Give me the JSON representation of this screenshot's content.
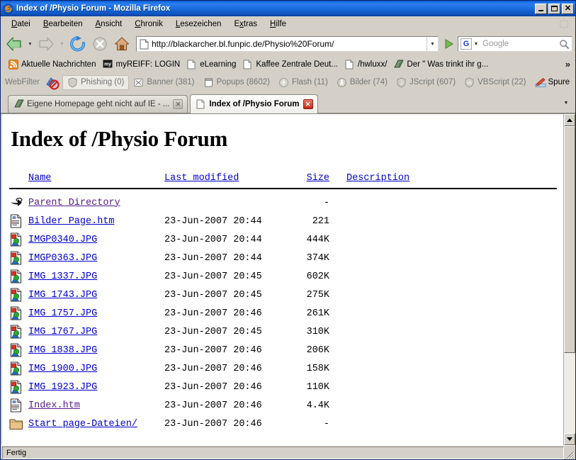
{
  "window": {
    "title": "Index of /Physio Forum - Mozilla Firefox",
    "minimize_label": "Minimize",
    "maximize_label": "Maximize",
    "close_label": "Close"
  },
  "menu": {
    "items": [
      {
        "label": "Datei",
        "accel": "D"
      },
      {
        "label": "Bearbeiten",
        "accel": "B"
      },
      {
        "label": "Ansicht",
        "accel": "A"
      },
      {
        "label": "Chronik",
        "accel": "C"
      },
      {
        "label": "Lesezeichen",
        "accel": "L"
      },
      {
        "label": "Extras",
        "accel": "x"
      },
      {
        "label": "Hilfe",
        "accel": "H"
      }
    ]
  },
  "toolbar": {
    "back_label": "Zurück",
    "forward_label": "Vor",
    "reload_label": "Neu laden",
    "stop_label": "Stopp",
    "home_label": "Startseite",
    "go_label": "Gehe zu"
  },
  "url_bar": {
    "value": "http://blackarcher.bl.funpic.de/Physio%20Forum/",
    "dropdown_label": "▼"
  },
  "search_bar": {
    "engine": "G",
    "placeholder": "Google",
    "value": ""
  },
  "bookmarks": {
    "items": [
      {
        "label": "Aktuelle Nachrichten",
        "icon": "rss-icon"
      },
      {
        "label": "myREIFF: LOGIN",
        "icon": "my-badge-icon"
      },
      {
        "label": "eLearning",
        "icon": "page-icon"
      },
      {
        "label": "Kaffee Zentrale Deut...",
        "icon": "page-icon"
      },
      {
        "label": "/hwluxx/",
        "icon": "page-icon"
      },
      {
        "label": "Der \" Was trinkt ihr g...",
        "icon": "book-icon"
      }
    ],
    "overflow_label": "»"
  },
  "webfilter": {
    "label": "WebFilter",
    "items": [
      {
        "label": "Phishing (0)",
        "icon": "shield-icon",
        "active": true
      },
      {
        "label": "Banner (381)",
        "icon": "banner-icon",
        "active": false
      },
      {
        "label": "Popups (8602)",
        "icon": "popup-icon",
        "active": false
      },
      {
        "label": "Flash (11)",
        "icon": "flash-icon",
        "active": false
      },
      {
        "label": "Bilder (74)",
        "icon": "image-icon",
        "active": false
      },
      {
        "label": "JScript (607)",
        "icon": "jscript-icon",
        "active": false
      },
      {
        "label": "VBScript (22)",
        "icon": "vbscript-icon",
        "active": false
      },
      {
        "label": "Spure",
        "icon": "pencil-icon",
        "active": false
      }
    ]
  },
  "tabs": {
    "list": [
      {
        "label": "Eigene Homepage geht nicht auf IE - ...",
        "active": false
      },
      {
        "label": "Index of /Physio Forum",
        "active": true
      }
    ],
    "dropdown_label": "▼"
  },
  "page": {
    "title": "Index of /Physio Forum",
    "columns": {
      "name": "Name",
      "last_modified": "Last modified",
      "size": "Size",
      "description": "Description"
    },
    "rows": [
      {
        "icon": "parent-dir-icon",
        "name": "Parent Directory",
        "date": "",
        "size": "-",
        "desc": "",
        "visited": true
      },
      {
        "icon": "text-doc-icon",
        "name": "Bilder Page.htm",
        "date": "23-Jun-2007 20:44",
        "size": "221",
        "desc": "",
        "visited": false
      },
      {
        "icon": "image-file-icon",
        "name": "IMGP0340.JPG",
        "date": "23-Jun-2007 20:44",
        "size": "444K",
        "desc": "",
        "visited": false
      },
      {
        "icon": "image-file-icon",
        "name": "IMGP0363.JPG",
        "date": "23-Jun-2007 20:44",
        "size": "374K",
        "desc": "",
        "visited": false
      },
      {
        "icon": "image-file-icon",
        "name": "IMG 1337.JPG",
        "date": "23-Jun-2007 20:45",
        "size": "602K",
        "desc": "",
        "visited": false
      },
      {
        "icon": "image-file-icon",
        "name": "IMG 1743.JPG",
        "date": "23-Jun-2007 20:45",
        "size": "275K",
        "desc": "",
        "visited": false
      },
      {
        "icon": "image-file-icon",
        "name": "IMG 1757.JPG",
        "date": "23-Jun-2007 20:46",
        "size": "261K",
        "desc": "",
        "visited": false
      },
      {
        "icon": "image-file-icon",
        "name": "IMG 1767.JPG",
        "date": "23-Jun-2007 20:45",
        "size": "310K",
        "desc": "",
        "visited": false
      },
      {
        "icon": "image-file-icon",
        "name": "IMG 1838.JPG",
        "date": "23-Jun-2007 20:46",
        "size": "206K",
        "desc": "",
        "visited": false
      },
      {
        "icon": "image-file-icon",
        "name": "IMG 1900.JPG",
        "date": "23-Jun-2007 20:46",
        "size": "158K",
        "desc": "",
        "visited": false
      },
      {
        "icon": "image-file-icon",
        "name": "IMG 1923.JPG",
        "date": "23-Jun-2007 20:46",
        "size": "110K",
        "desc": "",
        "visited": false
      },
      {
        "icon": "text-doc-icon",
        "name": "Index.htm",
        "date": "23-Jun-2007 20:46",
        "size": "4.4K",
        "desc": "",
        "visited": true
      },
      {
        "icon": "folder-icon",
        "name": "Start page-Dateien/",
        "date": "23-Jun-2007 20:46",
        "size": "-",
        "desc": "",
        "visited": false
      }
    ]
  },
  "status": {
    "text": "Fertig"
  },
  "colors": {
    "link": "#0000cc",
    "visited_link": "#551a8b",
    "titlebar": "#0a5ad4",
    "chrome": "#d4d0c8"
  }
}
